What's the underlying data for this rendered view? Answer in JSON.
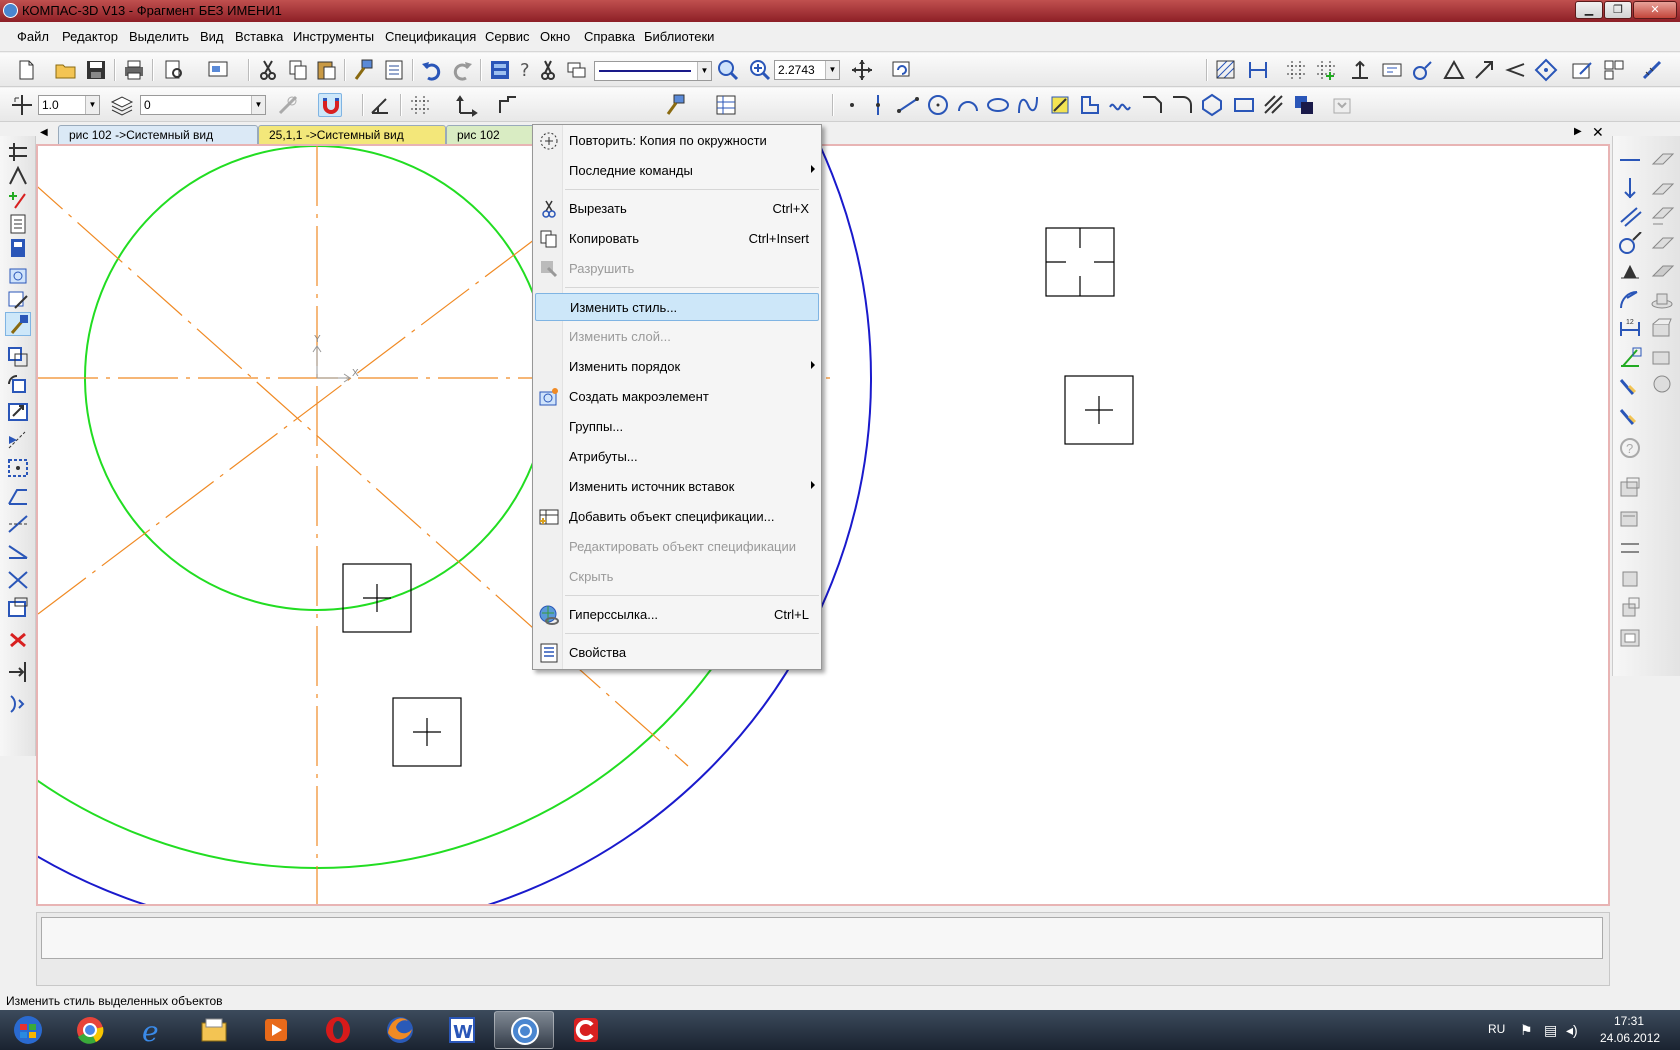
{
  "window": {
    "title": "КОМПАС-3D V13 - Фрагмент БЕЗ ИМЕНИ1",
    "minimize": "▁",
    "maximize": "❐",
    "close": "✕"
  },
  "menu": {
    "items": [
      "Файл",
      "Редактор",
      "Выделить",
      "Вид",
      "Вставка",
      "Инструменты",
      "Спецификация",
      "Сервис",
      "Окно",
      "Справка",
      "Библиотеки"
    ]
  },
  "toolbar1": {
    "zoom_value": "2.2743"
  },
  "toolbar2": {
    "step_value": "1.0",
    "layer_value": "0"
  },
  "tabs": [
    {
      "label": "рис 102 ->Системный вид"
    },
    {
      "label": "25,1,1 ->Системный вид"
    },
    {
      "label": "рис 102"
    }
  ],
  "context_menu": {
    "items": [
      {
        "label": "Повторить: Копия по окружности",
        "shortcut": "",
        "disabled": false,
        "submenu": false,
        "icon": "repeat-icon"
      },
      {
        "label": "Последние команды",
        "shortcut": "",
        "disabled": false,
        "submenu": true,
        "icon": ""
      },
      {
        "label": "Вырезать",
        "shortcut": "Ctrl+X",
        "disabled": false,
        "submenu": false,
        "icon": "scissors-icon"
      },
      {
        "label": "Копировать",
        "shortcut": "Ctrl+Insert",
        "disabled": false,
        "submenu": false,
        "icon": "copy-icon"
      },
      {
        "label": "Разрушить",
        "shortcut": "",
        "disabled": true,
        "submenu": false,
        "icon": "destroy-icon"
      },
      {
        "label": "Изменить стиль...",
        "shortcut": "",
        "disabled": false,
        "submenu": false,
        "icon": "",
        "highlighted": true
      },
      {
        "label": "Изменить слой...",
        "shortcut": "",
        "disabled": true,
        "submenu": false,
        "icon": ""
      },
      {
        "label": "Изменить порядок",
        "shortcut": "",
        "disabled": false,
        "submenu": true,
        "icon": ""
      },
      {
        "label": "Создать макроэлемент",
        "shortcut": "",
        "disabled": false,
        "submenu": false,
        "icon": "macro-icon"
      },
      {
        "label": "Группы...",
        "shortcut": "",
        "disabled": false,
        "submenu": false,
        "icon": ""
      },
      {
        "label": "Атрибуты...",
        "shortcut": "",
        "disabled": false,
        "submenu": false,
        "icon": ""
      },
      {
        "label": "Изменить источник вставок",
        "shortcut": "",
        "disabled": false,
        "submenu": true,
        "icon": ""
      },
      {
        "label": "Добавить объект спецификации...",
        "shortcut": "",
        "disabled": false,
        "submenu": false,
        "icon": "spec-add-icon"
      },
      {
        "label": "Редактировать объект спецификации",
        "shortcut": "",
        "disabled": true,
        "submenu": false,
        "icon": ""
      },
      {
        "label": "Скрыть",
        "shortcut": "",
        "disabled": true,
        "submenu": false,
        "icon": ""
      },
      {
        "label": "Гиперссылка...",
        "shortcut": "Ctrl+L",
        "disabled": false,
        "submenu": false,
        "icon": "hyperlink-icon"
      },
      {
        "label": "Свойства",
        "shortcut": "",
        "disabled": false,
        "submenu": false,
        "icon": "properties-icon"
      }
    ]
  },
  "canvas": {
    "axis_x_label": "X",
    "axis_y_label": "Y"
  },
  "status": {
    "text": "Изменить стиль выделенных объектов"
  },
  "tray": {
    "lang": "RU",
    "time": "17:31",
    "date": "24.06.2012"
  },
  "colors": {
    "green_circle": "#22dd22",
    "blue_circle": "#1a1acc",
    "axis_lines": "#f08a24",
    "highlight": "#cde7f9"
  }
}
